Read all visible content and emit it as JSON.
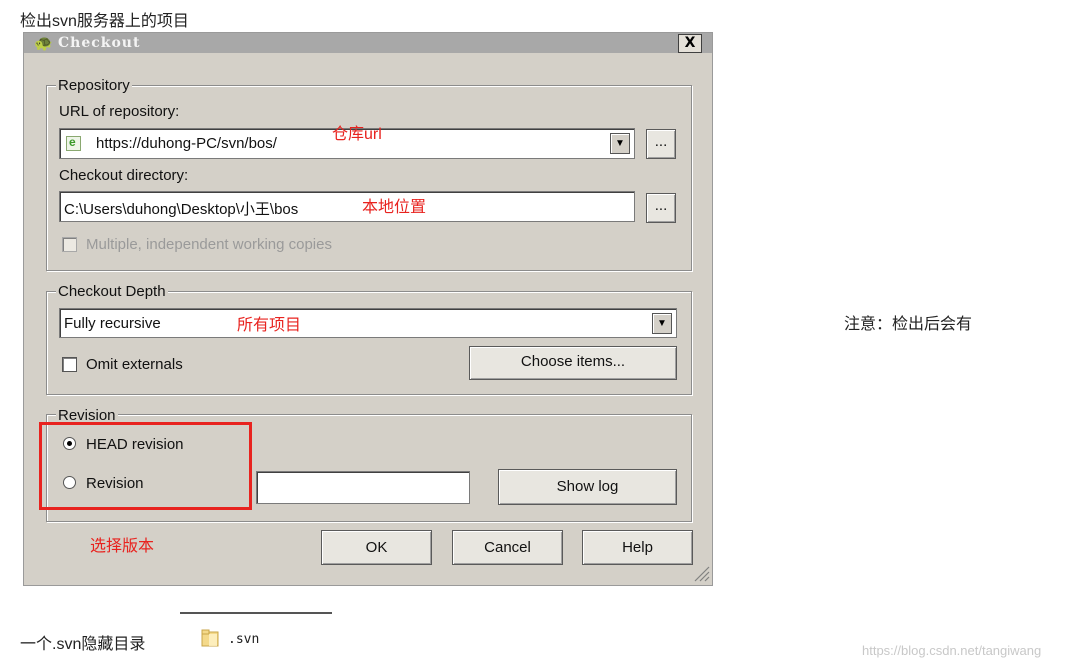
{
  "heading": "检出svn服务器上的项目",
  "dialog": {
    "title": "Checkout",
    "close_label": "X",
    "repository": {
      "legend": "Repository",
      "url_label": "URL of repository:",
      "url_value": "https://duhong-PC/svn/bos/",
      "url_note": "仓库url",
      "browse_label": "...",
      "dir_label": "Checkout directory:",
      "dir_value": "C:\\Users\\duhong\\Desktop\\小王\\bos",
      "dir_note": "本地位置",
      "browse2_label": "...",
      "multiple_label": "Multiple, independent working copies"
    },
    "depth": {
      "legend": "Checkout Depth",
      "value": "Fully recursive",
      "note": "所有项目",
      "omit_label": "Omit externals",
      "choose_label": "Choose items..."
    },
    "revision": {
      "legend": "Revision",
      "head_label": "HEAD revision",
      "revision_label": "Revision",
      "revision_value": "",
      "showlog_label": "Show log",
      "note": "选择版本"
    },
    "buttons": {
      "ok": "OK",
      "cancel": "Cancel",
      "help": "Help"
    }
  },
  "right_note": "注意：检出后会有",
  "bottom_text": "一个.svn隐藏目录",
  "svn_folder_name": ".svn",
  "watermark": "https://blog.csdn.net/tangiwang"
}
